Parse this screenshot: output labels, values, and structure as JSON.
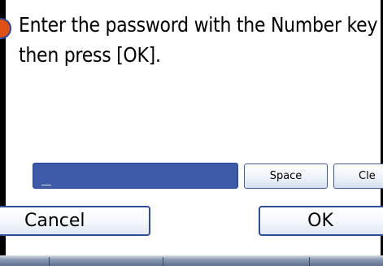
{
  "message": {
    "line1": "Enter the password with the Number key",
    "line2": "then press [OK]."
  },
  "password_field": {
    "value": "_"
  },
  "keys": {
    "space_label": "Space",
    "clear_label": "Cle"
  },
  "actions": {
    "cancel_label": "Cancel",
    "ok_label": "OK"
  },
  "icons": {
    "prompt": "question-mark-icon"
  },
  "colors": {
    "field": "#3c5aa8",
    "button_border": "#2f4d9c",
    "icon_fill": "#e05014"
  }
}
